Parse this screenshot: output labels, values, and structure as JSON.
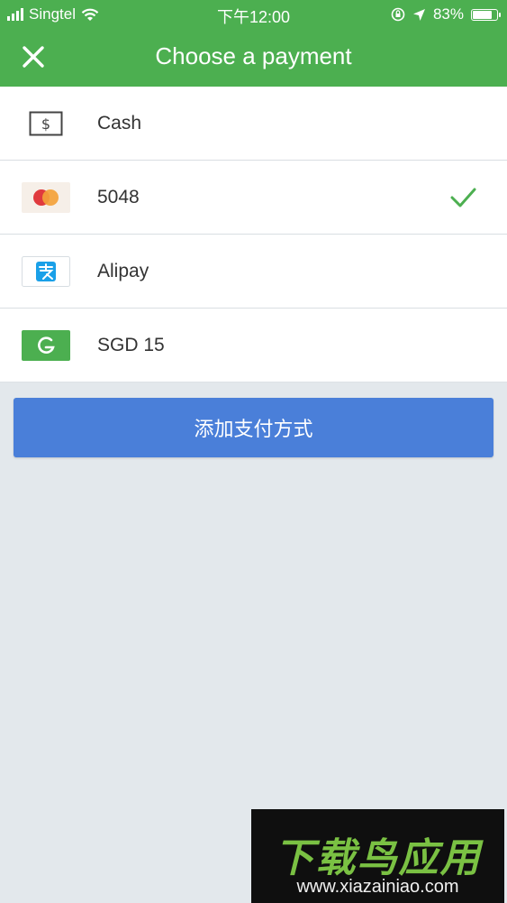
{
  "status_bar": {
    "carrier": "Singtel",
    "time": "下午12:00",
    "battery": "83%",
    "battery_level": 0.83,
    "icons": [
      "signal-icon",
      "wifi-icon",
      "orientation-lock-icon",
      "location-arrow-icon",
      "battery-icon"
    ]
  },
  "header": {
    "title": "Choose a payment",
    "close_icon": "close-icon"
  },
  "payment_methods": [
    {
      "label": "Cash",
      "icon": "cash-icon",
      "selected": false
    },
    {
      "label": "5048",
      "icon": "mastercard-icon",
      "selected": true
    },
    {
      "label": "Alipay",
      "icon": "alipay-icon",
      "selected": false
    },
    {
      "label": "SGD 15",
      "icon": "grabpay-icon",
      "selected": false
    }
  ],
  "add_button": {
    "label": "添加支付方式"
  },
  "watermark": {
    "logo_text": "下载鸟应用",
    "url": "www.xiazainiao.com"
  },
  "colors": {
    "header_green": "#4caf50",
    "check_green": "#4caf50",
    "button_blue": "#4a7fd9",
    "background": "#e3e8ec"
  }
}
